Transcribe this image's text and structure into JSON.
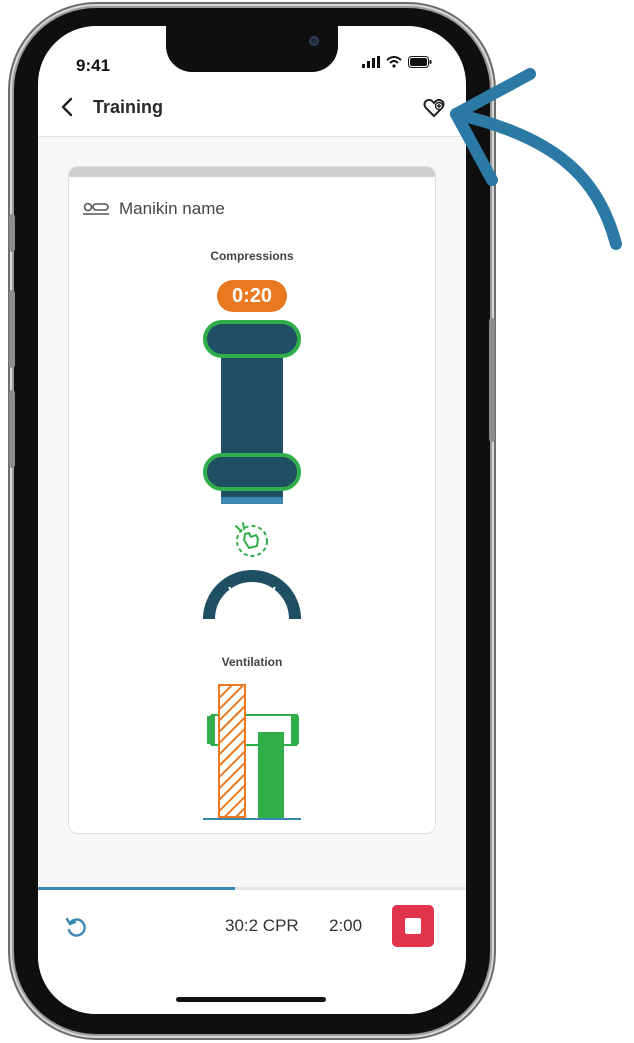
{
  "status_bar": {
    "time": "9:41"
  },
  "header": {
    "title": "Training"
  },
  "card": {
    "manikin_name": "Manikin name",
    "compressions": {
      "label": "Compressions",
      "timer": "0:20"
    },
    "ventilation": {
      "label": "Ventilation"
    }
  },
  "bottom_bar": {
    "mode": "30:2 CPR",
    "duration": "2:00",
    "progress": 0.46
  },
  "colors": {
    "accent_blue": "#3a87b3",
    "annotation_arrow": "#2b79a5",
    "timer_orange": "#ea7a22",
    "bar_dark": "#1f4f63",
    "good_green": "#2fae4a",
    "stop_red": "#e2334c"
  },
  "icons": {
    "back": "chevron-left-icon",
    "favorite": "heart-plus-icon",
    "manikin": "manikin-icon",
    "hand": "hand-compression-icon",
    "reset": "reset-icon",
    "stop": "stop-icon"
  }
}
